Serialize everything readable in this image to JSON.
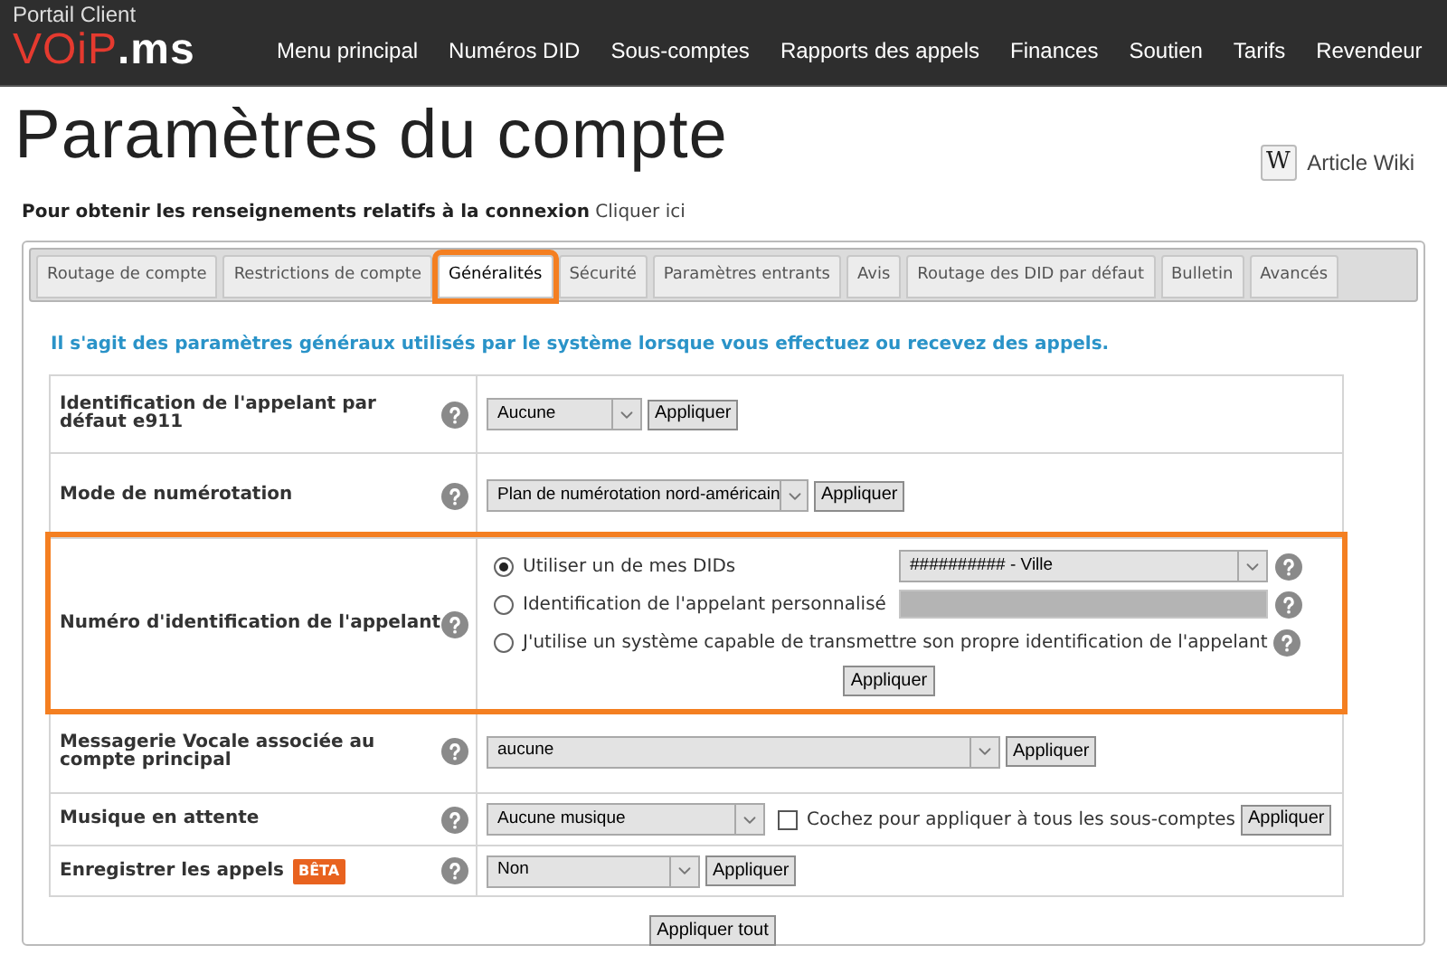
{
  "header": {
    "portal_label": "Portail Client",
    "logo": {
      "first": "VOiP",
      "second": ".ms"
    },
    "nav": [
      {
        "label": "Menu principal"
      },
      {
        "label": "Numéros DID"
      },
      {
        "label": "Sous-comptes"
      },
      {
        "label": "Rapports des appels"
      },
      {
        "label": "Finances"
      },
      {
        "label": "Soutien"
      },
      {
        "label": "Tarifs"
      },
      {
        "label": "Revendeur"
      }
    ]
  },
  "title": "Paramètres du compte",
  "wiki": {
    "icon_letter": "W",
    "label": "Article Wiki"
  },
  "login_info": {
    "text": "Pour obtenir les renseignements relatifs à la connexion",
    "link": "Cliquer ici"
  },
  "tabs": [
    {
      "label": "Routage de compte",
      "selected": false,
      "highlighted": false
    },
    {
      "label": "Restrictions de compte",
      "selected": false,
      "highlighted": false
    },
    {
      "label": "Généralités",
      "selected": true,
      "highlighted": true
    },
    {
      "label": "Sécurité",
      "selected": false,
      "highlighted": false
    },
    {
      "label": "Paramètres entrants",
      "selected": false,
      "highlighted": false
    },
    {
      "label": "Avis",
      "selected": false,
      "highlighted": false
    },
    {
      "label": "Routage des DID par défaut",
      "selected": false,
      "highlighted": false
    },
    {
      "label": "Bulletin",
      "selected": false,
      "highlighted": false
    },
    {
      "label": "Avancés",
      "selected": false,
      "highlighted": false
    }
  ],
  "intro": "Il s'agit des paramètres généraux utilisés par le système lorsque vous effectuez ou recevez des appels.",
  "settings": [
    {
      "kind": "select",
      "label": "Identification de l'appelant par défaut e911",
      "highlighted": false,
      "select": {
        "value": "Aucune"
      },
      "apply": "Appliquer"
    },
    {
      "kind": "select",
      "label": "Mode de numérotation",
      "highlighted": false,
      "select": {
        "value": "Plan de numérotation nord-américain"
      },
      "apply": "Appliquer"
    },
    {
      "kind": "radio_group",
      "label": "Numéro d'identification de l'appelant",
      "highlighted": true,
      "options": [
        {
          "label": "Utiliser un de mes DIDs",
          "selected": true,
          "control": {
            "kind": "select",
            "value": "########## - Ville"
          }
        },
        {
          "label": "Identification de l'appelant personnalisé",
          "selected": false,
          "control": {
            "kind": "input",
            "disabled": true
          }
        },
        {
          "label": "J'utilise un système capable de transmettre son propre identification de l'appelant",
          "selected": false
        }
      ],
      "apply": "Appliquer"
    },
    {
      "kind": "select",
      "label": "Messagerie Vocale associée au compte principal",
      "highlighted": false,
      "select": {
        "value": "aucune"
      },
      "apply": "Appliquer"
    },
    {
      "kind": "select_checkbox",
      "label": "Musique en attente",
      "highlighted": false,
      "select": {
        "value": "Aucune musique"
      },
      "checkbox": {
        "label": "Cochez pour appliquer à tous les sous-comptes",
        "checked": false
      },
      "apply": "Appliquer"
    },
    {
      "kind": "select",
      "label": "Enregistrer les appels",
      "badge": "BÊTA",
      "highlighted": false,
      "select": {
        "value": "Non"
      },
      "apply": "Appliquer"
    }
  ],
  "apply_all": "Appliquer tout"
}
